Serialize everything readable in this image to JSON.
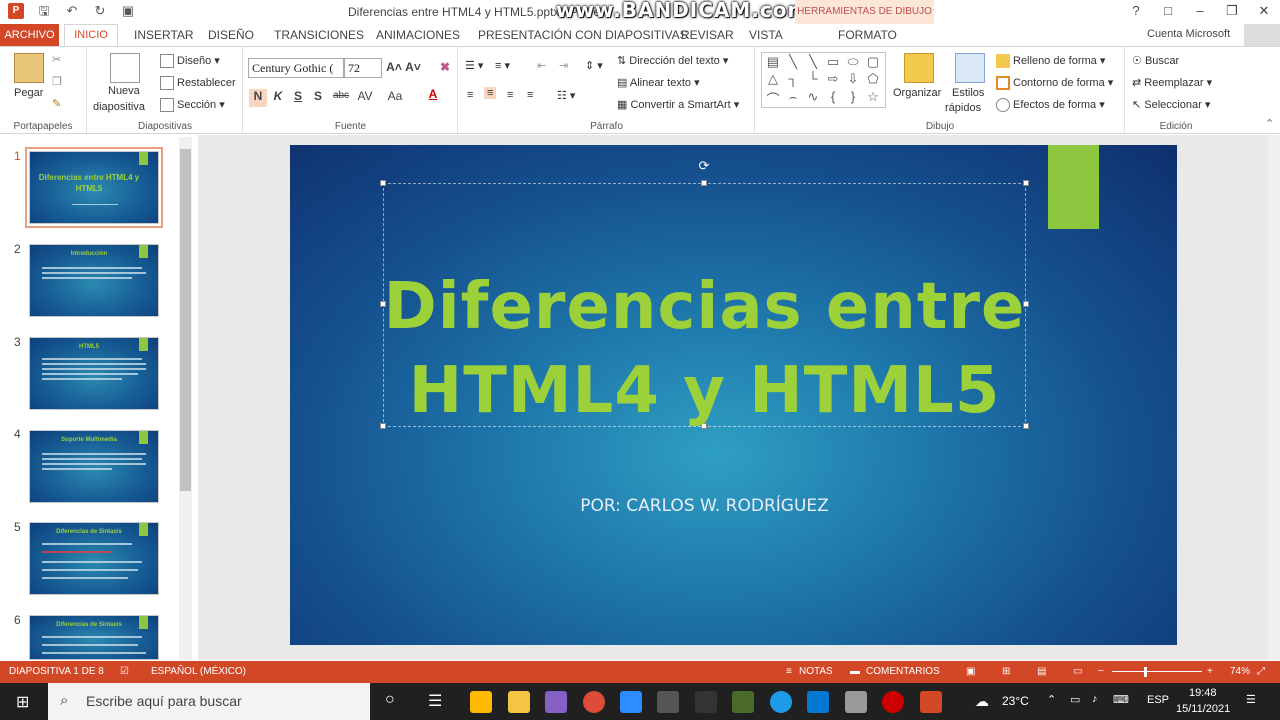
{
  "window": {
    "title": "Diferencias entre HTML4 y HTML5.pptx - Powe",
    "watermark": "www.BANDICAM.com",
    "contextual_header": "HERRAMIENTAS DE DIBUJO",
    "account": "Cuenta Microsoft"
  },
  "tabs": [
    "ARCHIVO",
    "INICIO",
    "INSERTAR",
    "DISEÑO",
    "TRANSICIONES",
    "ANIMACIONES",
    "PRESENTACIÓN CON DIAPOSITIVAS",
    "REVISAR",
    "VISTA",
    "FORMATO"
  ],
  "ribbon": {
    "portapapeles": {
      "label": "Portapapeles",
      "paste": "Pegar"
    },
    "diapositivas": {
      "label": "Diapositivas",
      "new_slide_1": "Nueva",
      "new_slide_2": "diapositiva",
      "layout": "Diseño",
      "reset": "Restablecer",
      "section": "Sección"
    },
    "fuente": {
      "label": "Fuente",
      "font_name": "Century Gothic (",
      "font_size": "72",
      "bold": "N",
      "italic": "K",
      "underline": "S",
      "shadow": "S",
      "strike": "abc",
      "spacing": "AV",
      "case": "Aa"
    },
    "parrafo": {
      "label": "Párrafo",
      "text_direction": "Dirección del texto",
      "align_text": "Alinear texto",
      "smartart": "Convertir a SmartArt"
    },
    "dibujo": {
      "label": "Dibujo",
      "arrange": "Organizar",
      "styles_1": "Estilos",
      "styles_2": "rápidos",
      "fill": "Relleno de forma",
      "outline": "Contorno de forma",
      "effects": "Efectos de forma"
    },
    "edicion": {
      "label": "Edición",
      "find": "Buscar",
      "replace": "Reemplazar",
      "select": "Seleccionar"
    }
  },
  "thumbnails": [
    {
      "num": "1",
      "title": "Diferencias entre HTML4 y HTML5"
    },
    {
      "num": "2",
      "title": "Introducción"
    },
    {
      "num": "3",
      "title": "HTML5"
    },
    {
      "num": "4",
      "title": "Soporte Multimedia"
    },
    {
      "num": "5",
      "title": "Diferencias de Sintaxis"
    },
    {
      "num": "6",
      "title": "Diferencias de Sintaxis"
    }
  ],
  "slide": {
    "title_line1": "Diferencias entre",
    "title_line2": "HTML4 y HTML5",
    "subtitle": "POR: CARLOS W. RODRÍGUEZ"
  },
  "status": {
    "slide_info": "DIAPOSITIVA 1 DE 8",
    "language": "ESPAÑOL (MÉXICO)",
    "notes": "NOTAS",
    "comments": "COMENTARIOS",
    "zoom": "74%"
  },
  "taskbar": {
    "search_placeholder": "Escribe aquí para buscar",
    "temperature": "23°C",
    "lang": "ESP",
    "time": "19:48",
    "date": "15/11/2021"
  },
  "colors": {
    "accent": "#d24726",
    "slide_title": "#9dd13a",
    "slide_bar": "#8dc63f"
  }
}
